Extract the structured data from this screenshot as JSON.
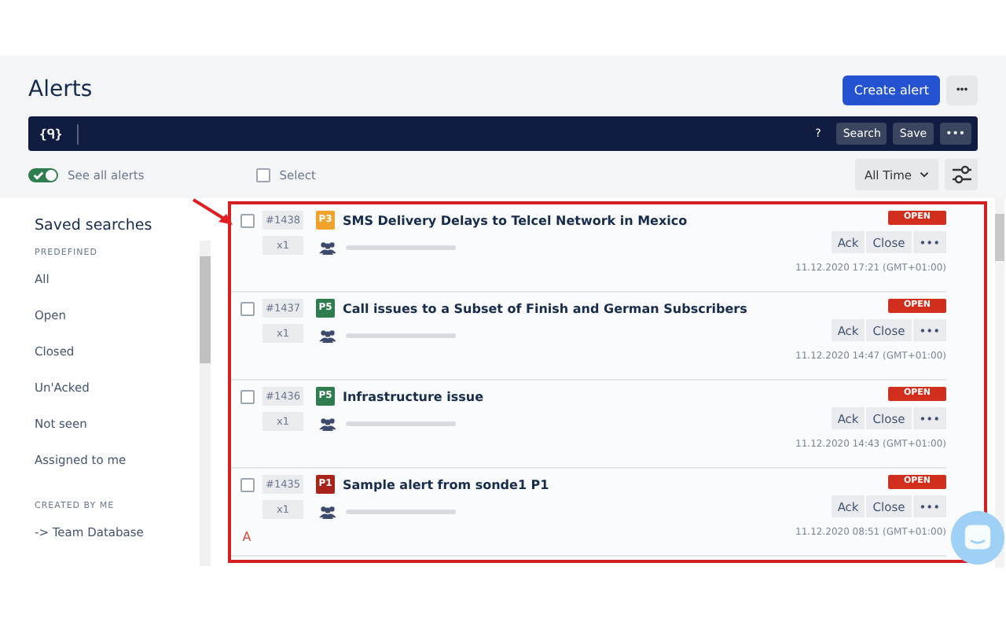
{
  "header": {
    "title": "Alerts",
    "create_button": "Create alert",
    "more_button": "•••"
  },
  "search_bar": {
    "query_icon": "{ᑫ}",
    "help": "?",
    "search_button": "Search",
    "save_button": "Save",
    "more_button": "•••"
  },
  "toolbar": {
    "see_all": {
      "label": "See all alerts",
      "on": true
    },
    "select": {
      "label": "Select",
      "checked": false
    },
    "time_filter": "All Time"
  },
  "sidebar": {
    "title": "Saved searches",
    "sections": [
      {
        "heading": "PREDEFINED",
        "items": [
          "All",
          "Open",
          "Closed",
          "Un'Acked",
          "Not seen",
          "Assigned to me"
        ]
      },
      {
        "heading": "CREATED BY ME",
        "items": [
          "-> Team Database"
        ]
      }
    ]
  },
  "alerts": [
    {
      "id": "#1438",
      "count": "x1",
      "priority": "P3",
      "color": "#f0a32a",
      "title": "SMS Delivery Delays to Telcel Network in Mexico",
      "status": "OPEN",
      "checked": false,
      "actions": [
        "Ack",
        "Close",
        "•••"
      ],
      "time": "11.12.2020 17:21 (GMT+01:00)"
    },
    {
      "id": "#1437",
      "count": "x1",
      "priority": "P5",
      "color": "#2f7d4e",
      "title": "Call issues to a Subset of Finish and German Subscribers",
      "status": "OPEN",
      "checked": false,
      "actions": [
        "Ack",
        "Close",
        "•••"
      ],
      "time": "11.12.2020 14:47 (GMT+01:00)"
    },
    {
      "id": "#1436",
      "count": "x1",
      "priority": "P5",
      "color": "#2f7d4e",
      "title": "Infrastructure issue",
      "status": "OPEN",
      "checked": false,
      "actions": [
        "Ack",
        "Close",
        "•••"
      ],
      "time": "11.12.2020 14:43 (GMT+01:00)"
    },
    {
      "id": "#1435",
      "count": "x1",
      "priority": "P1",
      "color": "#a8231a",
      "title": "Sample alert from sonde1 P1",
      "status": "OPEN",
      "checked": false,
      "actions": [
        "Ack",
        "Close",
        "•••"
      ],
      "time": "11.12.2020 08:51 (GMT+01:00)",
      "marker": "A"
    }
  ]
}
